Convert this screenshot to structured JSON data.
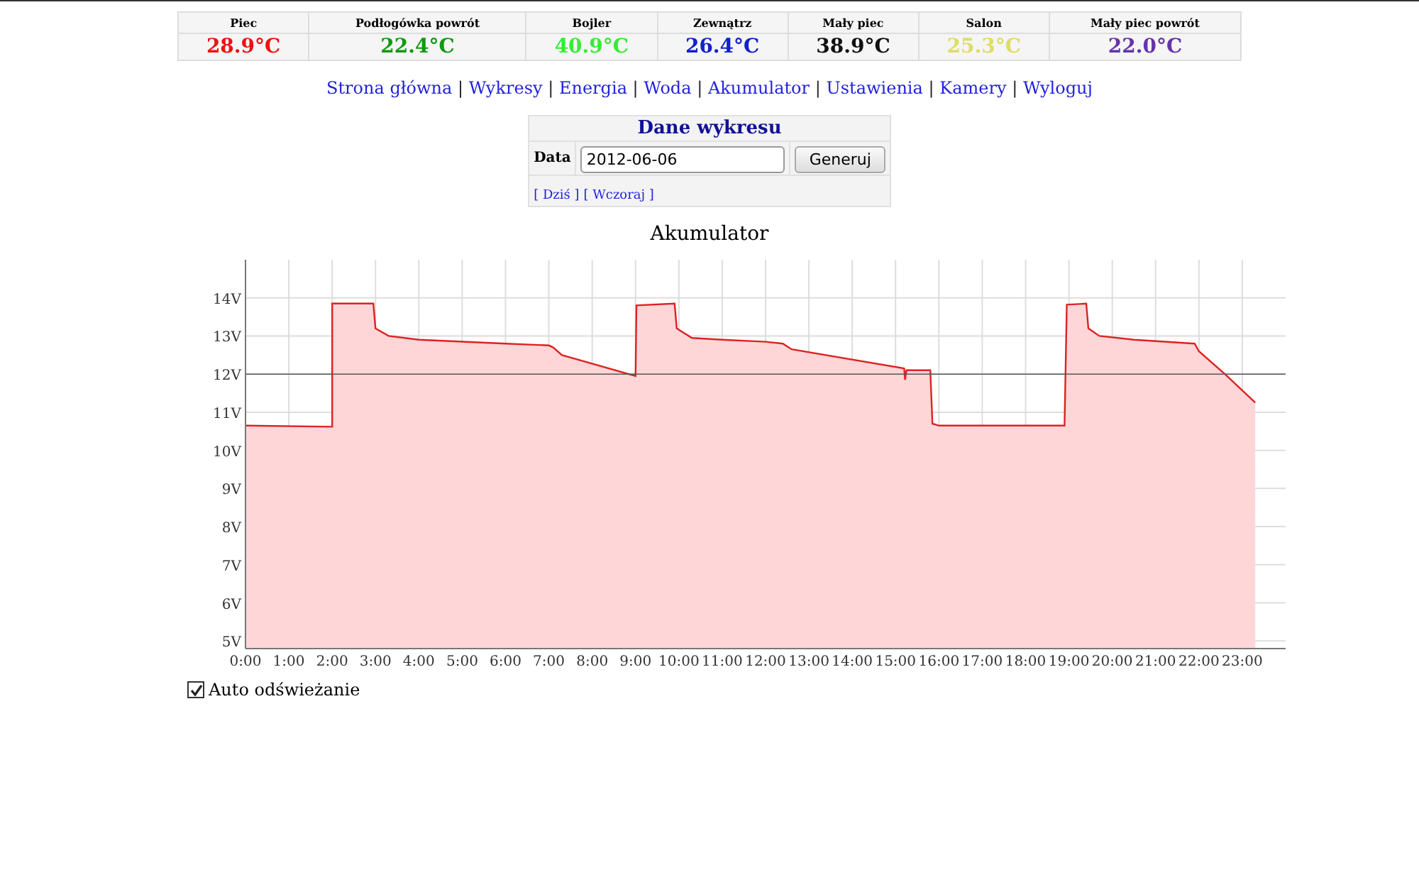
{
  "sensors": [
    {
      "name": "Piec",
      "value": "28.9°C",
      "color": "#ee1111"
    },
    {
      "name": "Podłogówka powrót",
      "value": "22.4°C",
      "color": "#119911"
    },
    {
      "name": "Bojler",
      "value": "40.9°C",
      "color": "#33ee33"
    },
    {
      "name": "Zewnątrz",
      "value": "26.4°C",
      "color": "#1122cc"
    },
    {
      "name": "Mały piec",
      "value": "38.9°C",
      "color": "#111111"
    },
    {
      "name": "Salon",
      "value": "25.3°C",
      "color": "#dddd66"
    },
    {
      "name": "Mały piec powrót",
      "value": "22.0°C",
      "color": "#6633aa"
    }
  ],
  "nav": [
    {
      "kind": "link",
      "text": "Strona główna"
    },
    {
      "kind": "separator",
      "text": "|"
    },
    {
      "kind": "link",
      "text": "Wykresy"
    },
    {
      "kind": "separator",
      "text": "|"
    },
    {
      "kind": "link",
      "text": "Energia"
    },
    {
      "kind": "separator",
      "text": "|"
    },
    {
      "kind": "link",
      "text": "Woda"
    },
    {
      "kind": "separator",
      "text": "|"
    },
    {
      "kind": "link",
      "text": "Akumulator"
    },
    {
      "kind": "separator",
      "text": "|"
    },
    {
      "kind": "link",
      "text": "Ustawienia"
    },
    {
      "kind": "separator",
      "text": "|"
    },
    {
      "kind": "link",
      "text": "Kamery"
    },
    {
      "kind": "separator",
      "text": "|"
    },
    {
      "kind": "link",
      "text": "Wyloguj"
    }
  ],
  "form": {
    "title": "Dane wykresu",
    "label": "Data",
    "value": "2012-06-06",
    "button": "Generuj",
    "links": [
      "[ Dziś ]",
      "[ Wczoraj ]"
    ]
  },
  "chart": {
    "chart_data": {
      "type": "area",
      "title": "Akumulator",
      "grid": true,
      "xlim": [
        0,
        24
      ],
      "ylim": [
        4.8,
        15
      ],
      "x": [
        0,
        2,
        2,
        2.95,
        3,
        3.3,
        4,
        6,
        7,
        7.1,
        7.3,
        9,
        9.02,
        9.9,
        9.95,
        10.3,
        11,
        12,
        12.4,
        12.6,
        15.2,
        15.22,
        15.25,
        15.8,
        15.85,
        16,
        18.9,
        18.95,
        19.4,
        19.45,
        19.7,
        20.5,
        21.9,
        22,
        22.6,
        23.3
      ],
      "series": [
        {
          "color": "#dd2222",
          "values": [
            10.65,
            10.62,
            13.85,
            13.85,
            13.2,
            13.0,
            12.9,
            12.8,
            12.75,
            12.7,
            12.5,
            11.95,
            13.8,
            13.85,
            13.2,
            12.95,
            12.9,
            12.85,
            12.8,
            12.65,
            12.15,
            11.85,
            12.1,
            12.1,
            10.7,
            10.65,
            10.65,
            13.82,
            13.85,
            13.2,
            13.0,
            12.9,
            12.8,
            12.6,
            12.0,
            11.25
          ]
        }
      ],
      "yticks": [
        {
          "value": 5,
          "label": "5V"
        },
        {
          "value": 6,
          "label": "6V"
        },
        {
          "value": 7,
          "label": "7V"
        },
        {
          "value": 8,
          "label": "8V"
        },
        {
          "value": 9,
          "label": "9V"
        },
        {
          "value": 10,
          "label": "10V"
        },
        {
          "value": 11,
          "label": "11V"
        },
        {
          "value": 12,
          "label": "12V"
        },
        {
          "value": 13,
          "label": "13V"
        },
        {
          "value": 14,
          "label": "14V"
        }
      ],
      "xticks": [
        {
          "value": 0,
          "label": "0:00"
        },
        {
          "value": 1,
          "label": "1:00"
        },
        {
          "value": 2,
          "label": "2:00"
        },
        {
          "value": 3,
          "label": "3:00"
        },
        {
          "value": 4,
          "label": "4:00"
        },
        {
          "value": 5,
          "label": "5:00"
        },
        {
          "value": 6,
          "label": "6:00"
        },
        {
          "value": 7,
          "label": "7:00"
        },
        {
          "value": 8,
          "label": "8:00"
        },
        {
          "value": 9,
          "label": "9:00"
        },
        {
          "value": 10,
          "label": "10:00"
        },
        {
          "value": 11,
          "label": "11:00"
        },
        {
          "value": 12,
          "label": "12:00"
        },
        {
          "value": 13,
          "label": "13:00"
        },
        {
          "value": 14,
          "label": "14:00"
        },
        {
          "value": 15,
          "label": "15:00"
        },
        {
          "value": 16,
          "label": "16:00"
        },
        {
          "value": 17,
          "label": "17:00"
        },
        {
          "value": 18,
          "label": "18:00"
        },
        {
          "value": 19,
          "label": "19:00"
        },
        {
          "value": 20,
          "label": "20:00"
        },
        {
          "value": 21,
          "label": "21:00"
        },
        {
          "value": 22,
          "label": "22:00"
        },
        {
          "value": 23,
          "label": "23:00"
        }
      ],
      "ref_lines": [
        {
          "axis": "y",
          "value": 12,
          "color": "#555555"
        }
      ]
    }
  },
  "auto_refresh": {
    "label": "Auto odświeżanie",
    "checked": true
  }
}
